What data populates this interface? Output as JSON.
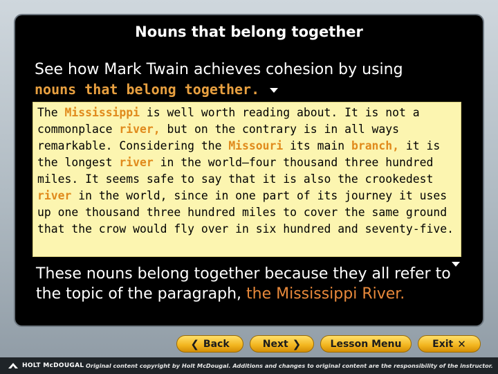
{
  "slide": {
    "title": "Nouns that belong together",
    "intro_prefix": "See how Mark Twain achieves cohesion by using",
    "intro_highlight": "nouns that belong together.",
    "passage": [
      "The ",
      "Mississippi",
      " is well worth reading about. It is not a commonplace ",
      "river,",
      " but on the contrary is in all ways remarkable. Considering the ",
      "Missouri",
      " its main ",
      "branch,",
      " it is the longest ",
      "river",
      " in the world—four thousand three hundred miles. It seems safe to say that it is also the crookedest ",
      "river",
      " in the world, since in one part of its journey it uses up one thousand three hundred miles to cover the same ground that the crow would fly over in six hundred and seventy-five."
    ],
    "conclusion_prefix": "These nouns belong together because they all refer to the topic of the paragraph, ",
    "conclusion_highlight": "the Mississippi River."
  },
  "nav": {
    "back": "Back",
    "next": "Next",
    "lesson_menu": "Lesson Menu",
    "exit": "Exit"
  },
  "footer": {
    "logo": "HOLT McDOUGAL",
    "copyright": "Original content copyright by Holt McDougal. Additions and changes to original content are the responsibility of the instructor."
  },
  "colors": {
    "highlight": "#e08a1c",
    "passage_bg": "#fcf5b0",
    "button": "#f2b41e"
  }
}
